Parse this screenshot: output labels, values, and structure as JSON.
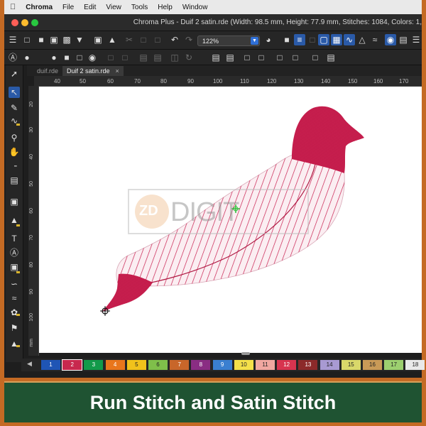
{
  "menubar": {
    "apple": "",
    "app_name": "Chroma",
    "items": [
      "File",
      "Edit",
      "View",
      "Tools",
      "Help",
      "Window"
    ]
  },
  "window": {
    "title": "Chroma Plus - Duif 2 satin.rde (Width: 98.5 mm, Height: 77.9 mm, Stitches: 1084, Colors: 1,"
  },
  "toolbar": {
    "zoom_value": "122%"
  },
  "tabs": [
    {
      "label": "duif.rde",
      "active": false
    },
    {
      "label": "Duif 2 satin.rde",
      "active": true,
      "close": "×"
    }
  ],
  "ruler": {
    "horizontal": [
      "40",
      "50",
      "60",
      "70",
      "80",
      "90",
      "100",
      "110",
      "120",
      "130",
      "140",
      "150",
      "160",
      "170"
    ],
    "vertical": [
      "20",
      "30",
      "40",
      "50",
      "60",
      "70",
      "80",
      "90",
      "100"
    ],
    "unit": "mm"
  },
  "watermark": {
    "logo": "ZD",
    "text": "DIGIT"
  },
  "palette": {
    "arrow": "◀",
    "swatches": [
      {
        "num": "1",
        "color": "#1f55b5",
        "text": "#ffffff"
      },
      {
        "num": "2",
        "color": "#c8284e",
        "text": "#ffffff"
      },
      {
        "num": "3",
        "color": "#129a4a",
        "text": "#ffffff"
      },
      {
        "num": "4",
        "color": "#e9761c",
        "text": "#ffffff"
      },
      {
        "num": "5",
        "color": "#f1c21b",
        "text": "#222222"
      },
      {
        "num": "6",
        "color": "#7fbf4a",
        "text": "#222222"
      },
      {
        "num": "7",
        "color": "#c8662a",
        "text": "#ffffff"
      },
      {
        "num": "8",
        "color": "#8a2d83",
        "text": "#ffffff"
      },
      {
        "num": "9",
        "color": "#3a7fd0",
        "text": "#ffffff"
      },
      {
        "num": "10",
        "color": "#f4e04a",
        "text": "#222222"
      },
      {
        "num": "11",
        "color": "#f0a7a0",
        "text": "#222222"
      },
      {
        "num": "12",
        "color": "#d7344f",
        "text": "#ffffff"
      },
      {
        "num": "13",
        "color": "#8c2a2a",
        "text": "#ffffff"
      },
      {
        "num": "14",
        "color": "#a89ad2",
        "text": "#222222"
      },
      {
        "num": "15",
        "color": "#d9d86a",
        "text": "#222222"
      },
      {
        "num": "16",
        "color": "#c99a57",
        "text": "#222222"
      },
      {
        "num": "17",
        "color": "#9ccf6f",
        "text": "#222222"
      },
      {
        "num": "18",
        "color": "#e9e9e9",
        "text": "#222222"
      }
    ]
  },
  "caption": {
    "text": "Run Stitch and Satin Stitch",
    "background": "#1f5332"
  },
  "colors": {
    "embroidery": "#c81e4e",
    "accent": "#2a5aa8",
    "frame": "#c46a24"
  }
}
